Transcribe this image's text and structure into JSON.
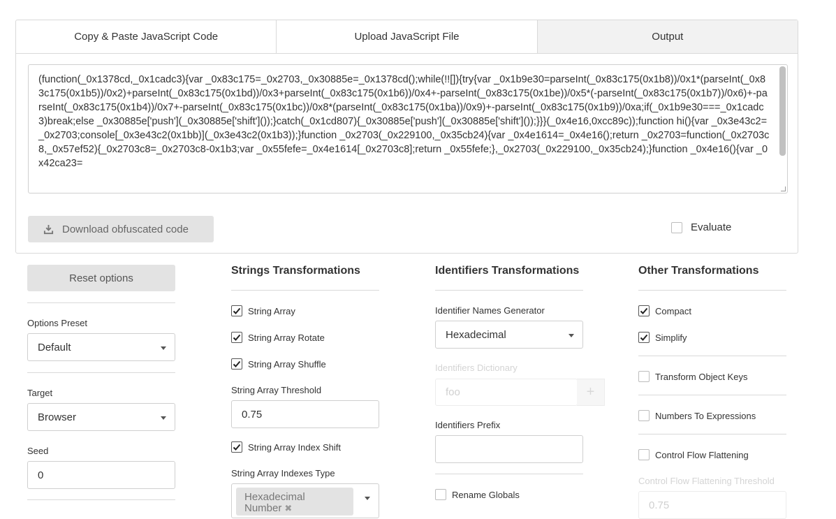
{
  "tabs": [
    {
      "label": "Copy & Paste JavaScript Code",
      "active": false
    },
    {
      "label": "Upload JavaScript File",
      "active": false
    },
    {
      "label": "Output",
      "active": true
    }
  ],
  "output": {
    "code": "(function(_0x1378cd,_0x1cadc3){var _0x83c175=_0x2703,_0x30885e=_0x1378cd();while(!![]){try{var _0x1b9e30=parseInt(_0x83c175(0x1b8))/0x1*(parseInt(_0x83c175(0x1b5))/0x2)+parseInt(_0x83c175(0x1bd))/0x3+parseInt(_0x83c175(0x1b6))/0x4+-parseInt(_0x83c175(0x1be))/0x5*(-parseInt(_0x83c175(0x1b7))/0x6)+-parseInt(_0x83c175(0x1b4))/0x7+-parseInt(_0x83c175(0x1bc))/0x8*(parseInt(_0x83c175(0x1ba))/0x9)+-parseInt(_0x83c175(0x1b9))/0xa;if(_0x1b9e30===_0x1cadc3)break;else _0x30885e['push'](_0x30885e['shift']());}catch(_0x1cd807){_0x30885e['push'](_0x30885e['shift']());}}}(_0x4e16,0xcc89c));function hi(){var _0x3e43c2=_0x2703;console[_0x3e43c2(0x1bb)](_0x3e43c2(0x1b3));}function _0x2703(_0x229100,_0x35cb24){var _0x4e1614=_0x4e16();return _0x2703=function(_0x2703c8,_0x57ef52){_0x2703c8=_0x2703c8-0x1b3;var _0x55fefe=_0x4e1614[_0x2703c8];return _0x55fefe;},_0x2703(_0x229100,_0x35cb24);}function _0x4e16(){var _0x42ca23=",
    "download_label": "Download obfuscated code",
    "evaluate_label": "Evaluate",
    "evaluate_checked": false
  },
  "left": {
    "reset_label": "Reset options",
    "preset_label": "Options Preset",
    "preset_value": "Default",
    "target_label": "Target",
    "target_value": "Browser",
    "seed_label": "Seed",
    "seed_value": "0"
  },
  "strings": {
    "heading": "Strings Transformations",
    "string_array": "String Array",
    "string_array_rotate": "String Array Rotate",
    "string_array_shuffle": "String Array Shuffle",
    "threshold_label": "String Array Threshold",
    "threshold_value": "0.75",
    "index_shift": "String Array Index Shift",
    "indexes_type_label": "String Array Indexes Type",
    "indexes_type_tag": "Hexadecimal Number"
  },
  "identifiers": {
    "heading": "Identifiers Transformations",
    "generator_label": "Identifier Names Generator",
    "generator_value": "Hexadecimal",
    "dictionary_label": "Identifiers Dictionary",
    "dictionary_placeholder": "foo",
    "prefix_label": "Identifiers Prefix",
    "prefix_value": "",
    "rename_globals": "Rename Globals"
  },
  "other": {
    "heading": "Other Transformations",
    "compact": "Compact",
    "simplify": "Simplify",
    "transform_object_keys": "Transform Object Keys",
    "numbers_to_expressions": "Numbers To Expressions",
    "control_flow_flattening": "Control Flow Flattening",
    "cff_threshold_label": "Control Flow Flattening Threshold",
    "cff_threshold_value": "0.75"
  }
}
